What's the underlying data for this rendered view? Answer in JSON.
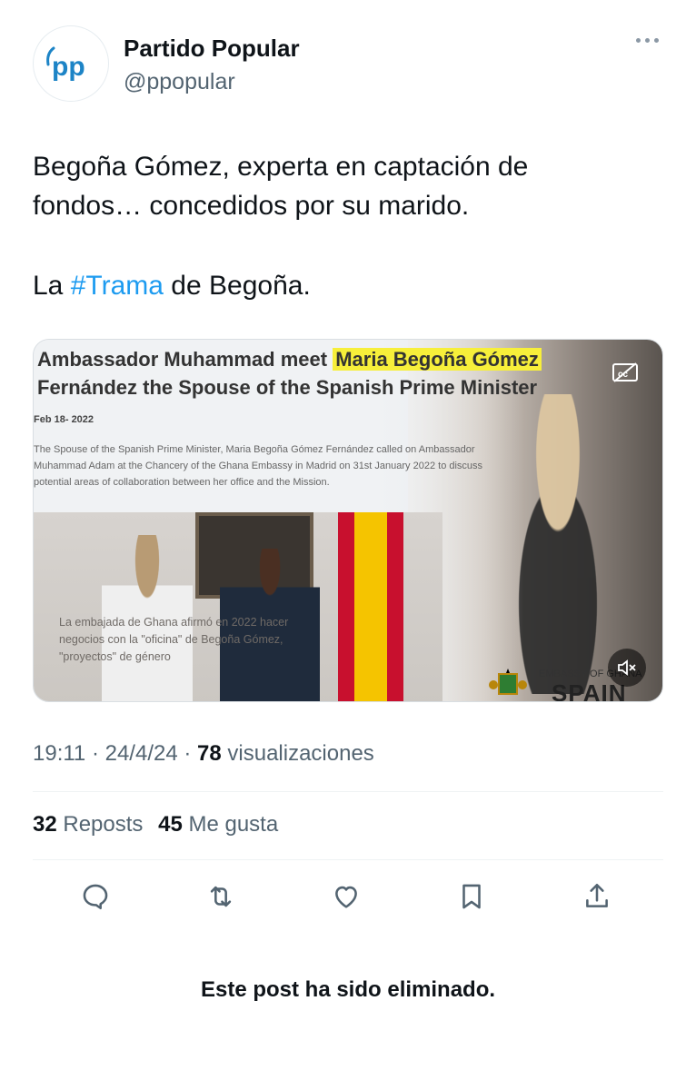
{
  "author": {
    "name": "Partido Popular",
    "handle": "@ppopular",
    "avatar_text": "pp"
  },
  "tweet": {
    "line1": "Begoña Gómez, experta en captación de",
    "line2": "fondos… concedidos por su marido.",
    "line3_prefix": "La ",
    "hashtag": "#Trama",
    "line3_suffix": " de Begoña."
  },
  "media": {
    "headline_part1": "Ambassador Muhammad meet ",
    "headline_highlight": "Maria Begoña Gómez",
    "headline_line2": "Fernández the Spouse of the Spanish Prime Minister",
    "date": "Feb 18- 2022",
    "body": "The Spouse of the Spanish Prime Minister, Maria Begoña Gómez Fernández called on Ambassador Muhammad Adam at the Chancery of the Ghana Embassy in Madrid on 31st January 2022 to discuss potential areas of collaboration between her office and the Mission.",
    "overlay": "La embajada de Ghana afirmó en 2022 hacer negocios con la \"oficina\" de Begoña Gómez, \"proyectos\" de género",
    "embassy_label": "EMBASSY OF GHANA",
    "spain_label": "SPAIN",
    "cc_icon": "closed-captions-icon",
    "mute_icon": "volume-muted-icon"
  },
  "meta": {
    "time": "19:11",
    "sep1": " · ",
    "date": "24/4/24",
    "sep2": " · ",
    "views_count": "78",
    "views_label": " visualizaciones"
  },
  "stats": {
    "reposts_count": "32",
    "reposts_label": " Reposts",
    "likes_count": "45",
    "likes_label": " Me gusta"
  },
  "actions": [
    "reply-icon",
    "repost-icon",
    "like-icon",
    "bookmark-icon",
    "share-icon"
  ],
  "footer": {
    "deleted_notice": "Este post ha sido eliminado."
  },
  "colors": {
    "link": "#1d9bf0",
    "muted": "#536471",
    "text": "#0f1419",
    "highlight": "#f7ef3a",
    "pp_blue": "#1d84c6"
  }
}
